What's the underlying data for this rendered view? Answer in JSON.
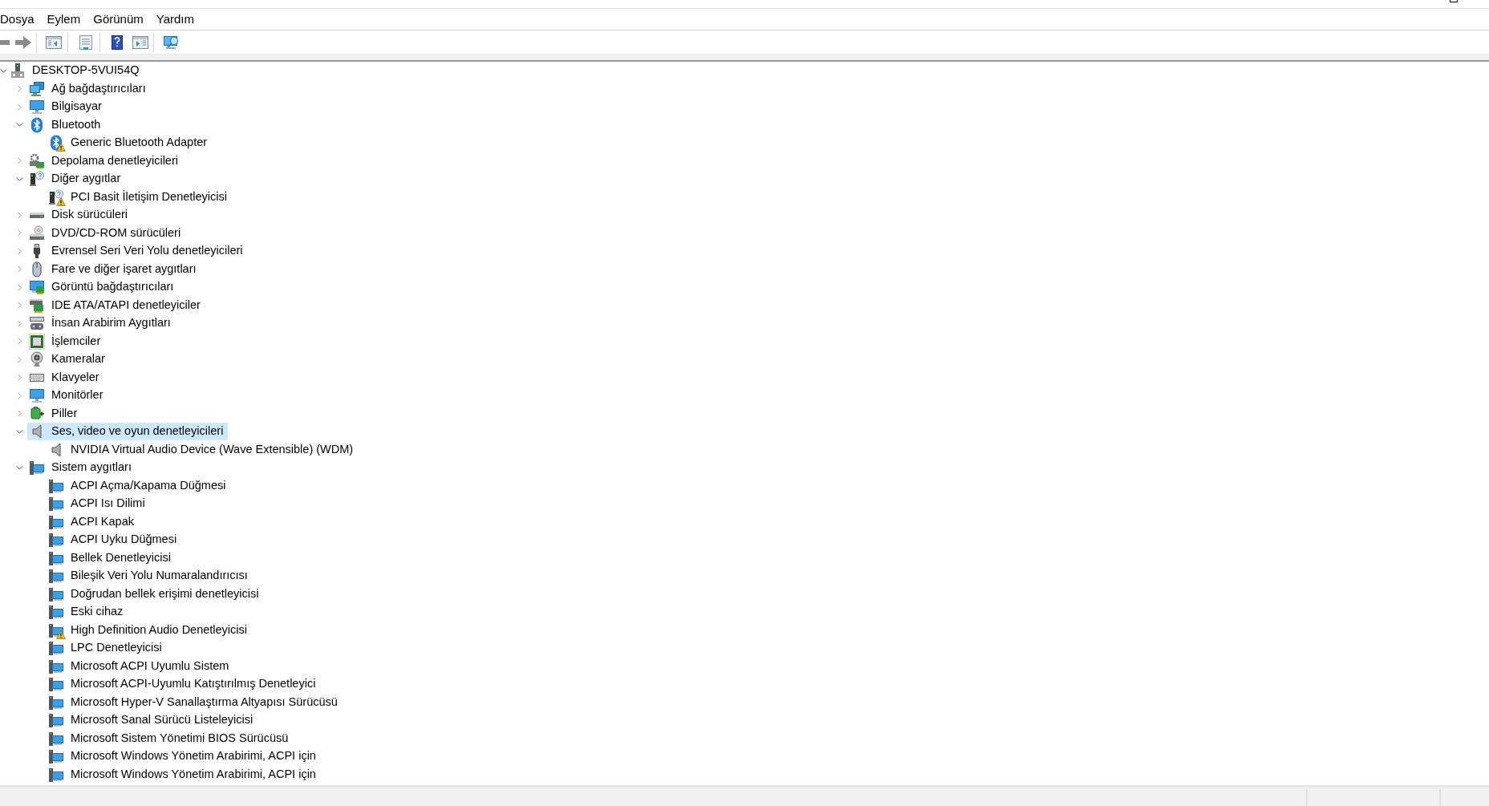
{
  "menu_bar": [
    "Dosya",
    "Eylem",
    "Görünüm",
    "Yardım"
  ],
  "tree": {
    "label": "DESKTOP-5VUI54Q",
    "expanded": true,
    "selected": false,
    "children": [
      {
        "label": "Ağ bağdaştırıcıları",
        "expanded": false,
        "selected": false
      },
      {
        "label": "Bilgisayar",
        "expanded": false,
        "selected": false
      },
      {
        "label": "Bluetooth",
        "expanded": true,
        "selected": false,
        "children": [
          {
            "label": "Generic Bluetooth Adapter",
            "selected": false,
            "warning": true
          }
        ]
      },
      {
        "label": "Depolama denetleyicileri",
        "expanded": false,
        "selected": false
      },
      {
        "label": "Diğer aygıtlar",
        "expanded": true,
        "selected": false,
        "children": [
          {
            "label": "PCI Basit İletişim Denetleyicisi",
            "selected": false,
            "warning": true
          }
        ]
      },
      {
        "label": "Disk sürücüleri",
        "expanded": false,
        "selected": false
      },
      {
        "label": "DVD/CD-ROM sürücüleri",
        "expanded": false,
        "selected": false
      },
      {
        "label": "Evrensel Seri Veri Yolu denetleyicileri",
        "expanded": false,
        "selected": false
      },
      {
        "label": "Fare ve diğer işaret aygıtları",
        "expanded": false,
        "selected": false
      },
      {
        "label": "Görüntü bağdaştırıcıları",
        "expanded": false,
        "selected": false
      },
      {
        "label": "IDE ATA/ATAPI denetleyiciler",
        "expanded": false,
        "selected": false
      },
      {
        "label": "İnsan Arabirim Aygıtları",
        "expanded": false,
        "selected": false
      },
      {
        "label": "İşlemciler",
        "expanded": false,
        "selected": false
      },
      {
        "label": "Kameralar",
        "expanded": false,
        "selected": false
      },
      {
        "label": "Klavyeler",
        "expanded": false,
        "selected": false
      },
      {
        "label": "Monitörler",
        "expanded": false,
        "selected": false
      },
      {
        "label": "Piller",
        "expanded": false,
        "selected": false
      },
      {
        "label": "Ses, video ve oyun denetleyicileri",
        "expanded": true,
        "selected": true,
        "children": [
          {
            "label": "NVIDIA Virtual Audio Device (Wave Extensible) (WDM)",
            "selected": false,
            "warning": false
          }
        ]
      },
      {
        "label": "Sistem aygıtları",
        "expanded": true,
        "selected": false,
        "children": [
          {
            "label": "ACPI Açma/Kapama Düğmesi",
            "selected": false,
            "warning": false
          },
          {
            "label": "ACPI Isı Dilimi",
            "selected": false,
            "warning": false
          },
          {
            "label": "ACPI Kapak",
            "selected": false,
            "warning": false
          },
          {
            "label": "ACPI Uyku Düğmesi",
            "selected": false,
            "warning": false
          },
          {
            "label": "Bellek Denetleyicisi",
            "selected": false,
            "warning": false
          },
          {
            "label": "Bileşik Veri Yolu Numaralandırıcısı",
            "selected": false,
            "warning": false
          },
          {
            "label": "Doğrudan bellek erişimi denetleyicisi",
            "selected": false,
            "warning": false
          },
          {
            "label": "Eski cihaz",
            "selected": false,
            "warning": false
          },
          {
            "label": "High Definition Audio Denetleyicisi",
            "selected": false,
            "warning": true
          },
          {
            "label": "LPC Denetleyicisi",
            "selected": false,
            "warning": false
          },
          {
            "label": "Microsoft ACPI Uyumlu Sistem",
            "selected": false,
            "warning": false
          },
          {
            "label": "Microsoft ACPI-Uyumlu Katıştırılmış Denetleyici",
            "selected": false,
            "warning": false
          },
          {
            "label": "Microsoft Hyper-V Sanallaştırma Altyapısı Sürücüsü",
            "selected": false,
            "warning": false
          },
          {
            "label": "Microsoft Sanal Sürücü Listeleyicisi",
            "selected": false,
            "warning": false
          },
          {
            "label": "Microsoft Sistem Yönetimi BIOS Sürücüsü",
            "selected": false,
            "warning": false
          },
          {
            "label": "Microsoft Windows Yönetim Arabirimi, ACPI için",
            "selected": false,
            "warning": false
          },
          {
            "label": "Microsoft Windows Yönetim Arabirimi, ACPI için",
            "selected": false,
            "warning": false
          }
        ]
      }
    ]
  }
}
